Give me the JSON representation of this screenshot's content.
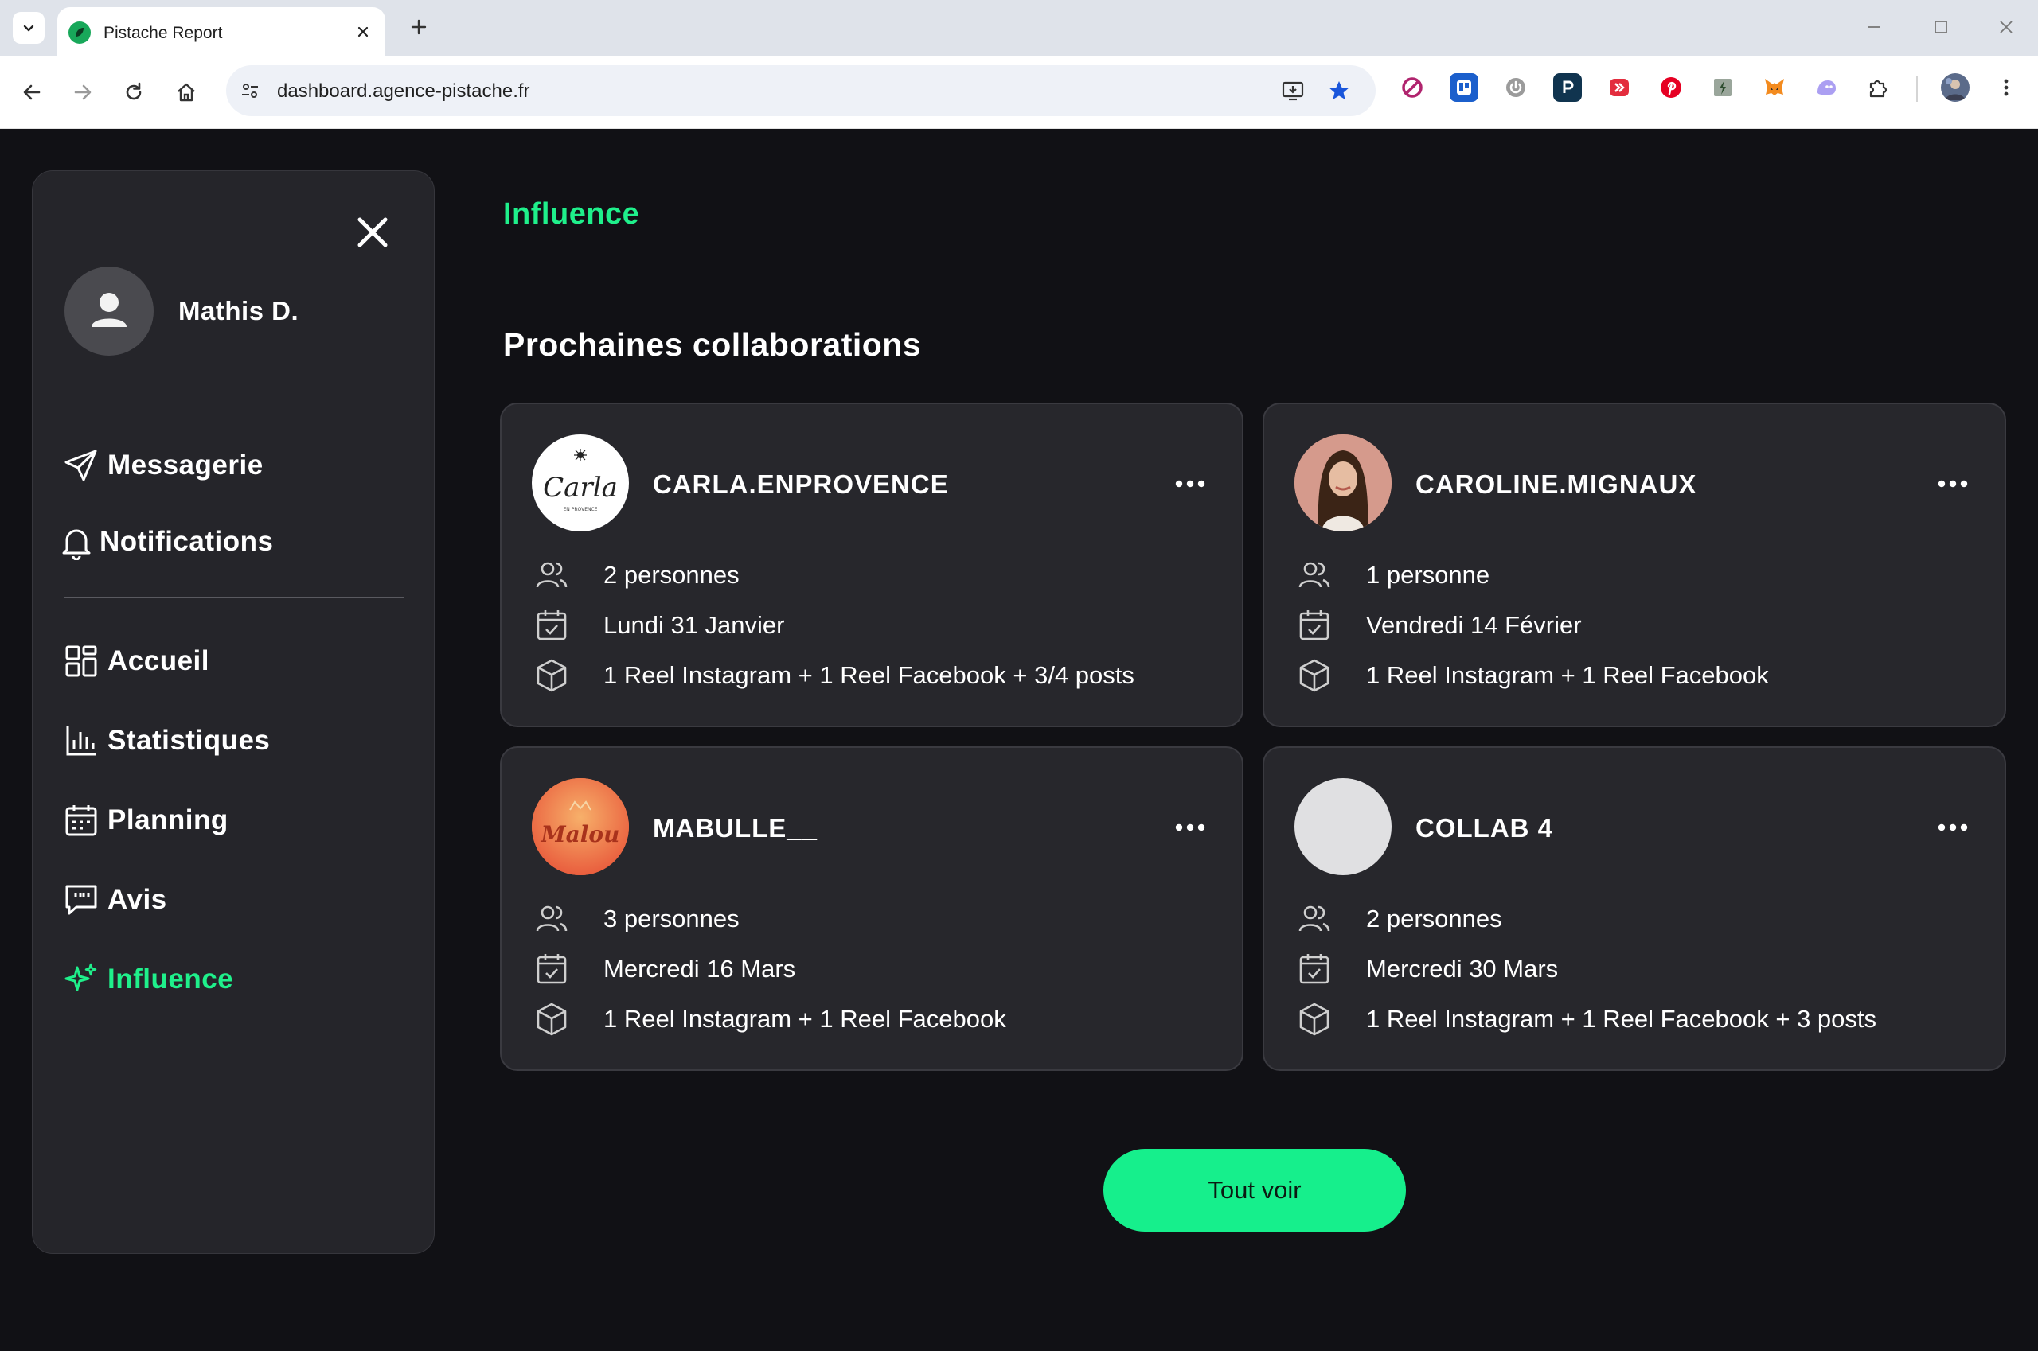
{
  "browser": {
    "tab_title": "Pistache Report",
    "url": "dashboard.agence-pistache.fr"
  },
  "sidebar": {
    "user_name": "Mathis D.",
    "items": [
      {
        "label": "Messagerie",
        "icon": "send-icon"
      },
      {
        "label": "Notifications",
        "icon": "bell-icon"
      },
      {
        "label": "Accueil",
        "icon": "dashboard-icon"
      },
      {
        "label": "Statistiques",
        "icon": "bar-chart-icon"
      },
      {
        "label": "Planning",
        "icon": "calendar-icon"
      },
      {
        "label": "Avis",
        "icon": "review-icon"
      },
      {
        "label": "Influence",
        "icon": "sparkle-icon",
        "active": true
      }
    ]
  },
  "main": {
    "page_title": "Influence",
    "section_title": "Prochaines collaborations",
    "cards": [
      {
        "name": "CARLA.ENPROVENCE",
        "avatar_text": "Carla",
        "avatar_subtext": "EN PROVENCE",
        "people": "2 personnes",
        "date": "Lundi 31 Janvier",
        "deliverables": "1 Reel Instagram + 1 Reel Facebook + 3/4 posts"
      },
      {
        "name": "CAROLINE.MIGNAUX",
        "people": "1 personne",
        "date": "Vendredi 14 Février",
        "deliverables": "1 Reel Instagram + 1 Reel Facebook"
      },
      {
        "name": "MABULLE__",
        "avatar_text": "Malou",
        "people": "3 personnes",
        "date": "Mercredi 16 Mars",
        "deliverables": "1 Reel Instagram + 1 Reel Facebook"
      },
      {
        "name": "COLLAB 4",
        "people": "2 personnes",
        "date": "Mercredi 30 Mars",
        "deliverables": "1 Reel Instagram + 1 Reel Facebook + 3 posts"
      }
    ],
    "see_all_label": "Tout voir"
  },
  "colors": {
    "accent": "#1ff08b",
    "background": "#111115",
    "panel": "#25252a"
  }
}
